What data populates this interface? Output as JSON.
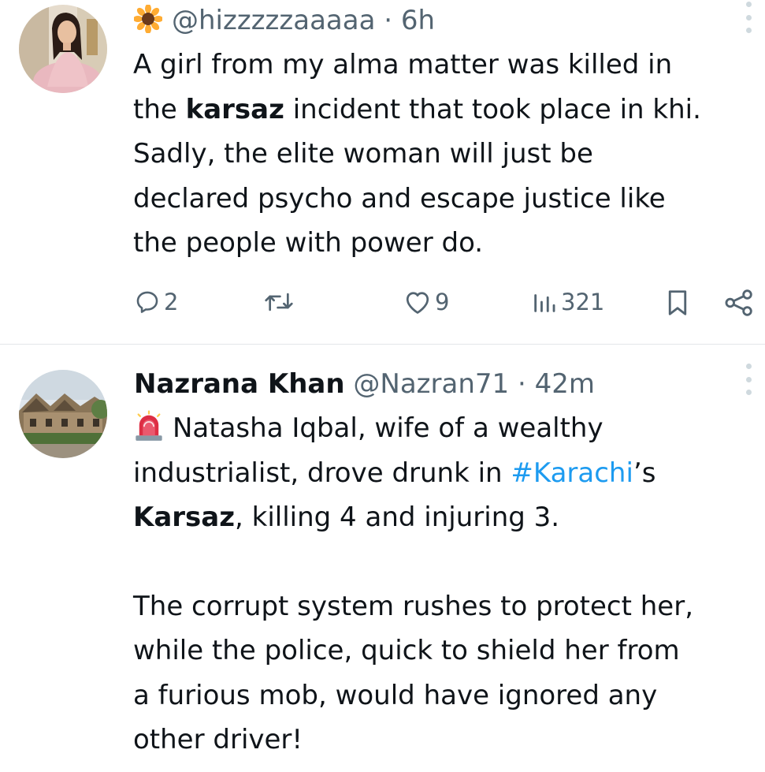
{
  "tweets": [
    {
      "handle": "@hizzzzzaaaaa",
      "separator": "·",
      "time": "6h",
      "emoji_icon": "sunflower-emoji",
      "text": {
        "line1": "A girl from my alma matter was killed in",
        "line2_prefix": "the ",
        "line2_bold": "karsaz",
        "line2_suffix": " incident that took place in khi.",
        "line3": "Sadly, the elite woman will just be",
        "line4": "declared psycho and escape justice like",
        "line5": "the people with power do."
      },
      "stats": {
        "replies": "2",
        "reposts": "",
        "likes": "9",
        "views": "321"
      }
    },
    {
      "name": "Nazrana Khan",
      "handle": "@Nazran71",
      "separator": "·",
      "time": "42m",
      "emoji_icon": "police-siren-emoji",
      "text": {
        "line1": "Natasha Iqbal, wife of a wealthy",
        "line2_prefix": "industrialist, drove drunk in ",
        "line2_hashtag": "#Karachi",
        "line2_suffix": "’s",
        "line3_bold": "Karsaz",
        "line3_suffix": ", killing 4 and injuring 3.",
        "line4": "The corrupt system rushes to protect her,",
        "line5": "while the police, quick to shield her from",
        "line6": "a furious mob, would have ignored any",
        "line7": "other driver!"
      }
    }
  ],
  "colors": {
    "text": "#0f1419",
    "secondary": "#536471",
    "link": "#1d9bf0",
    "divider": "#e3e6ea"
  }
}
